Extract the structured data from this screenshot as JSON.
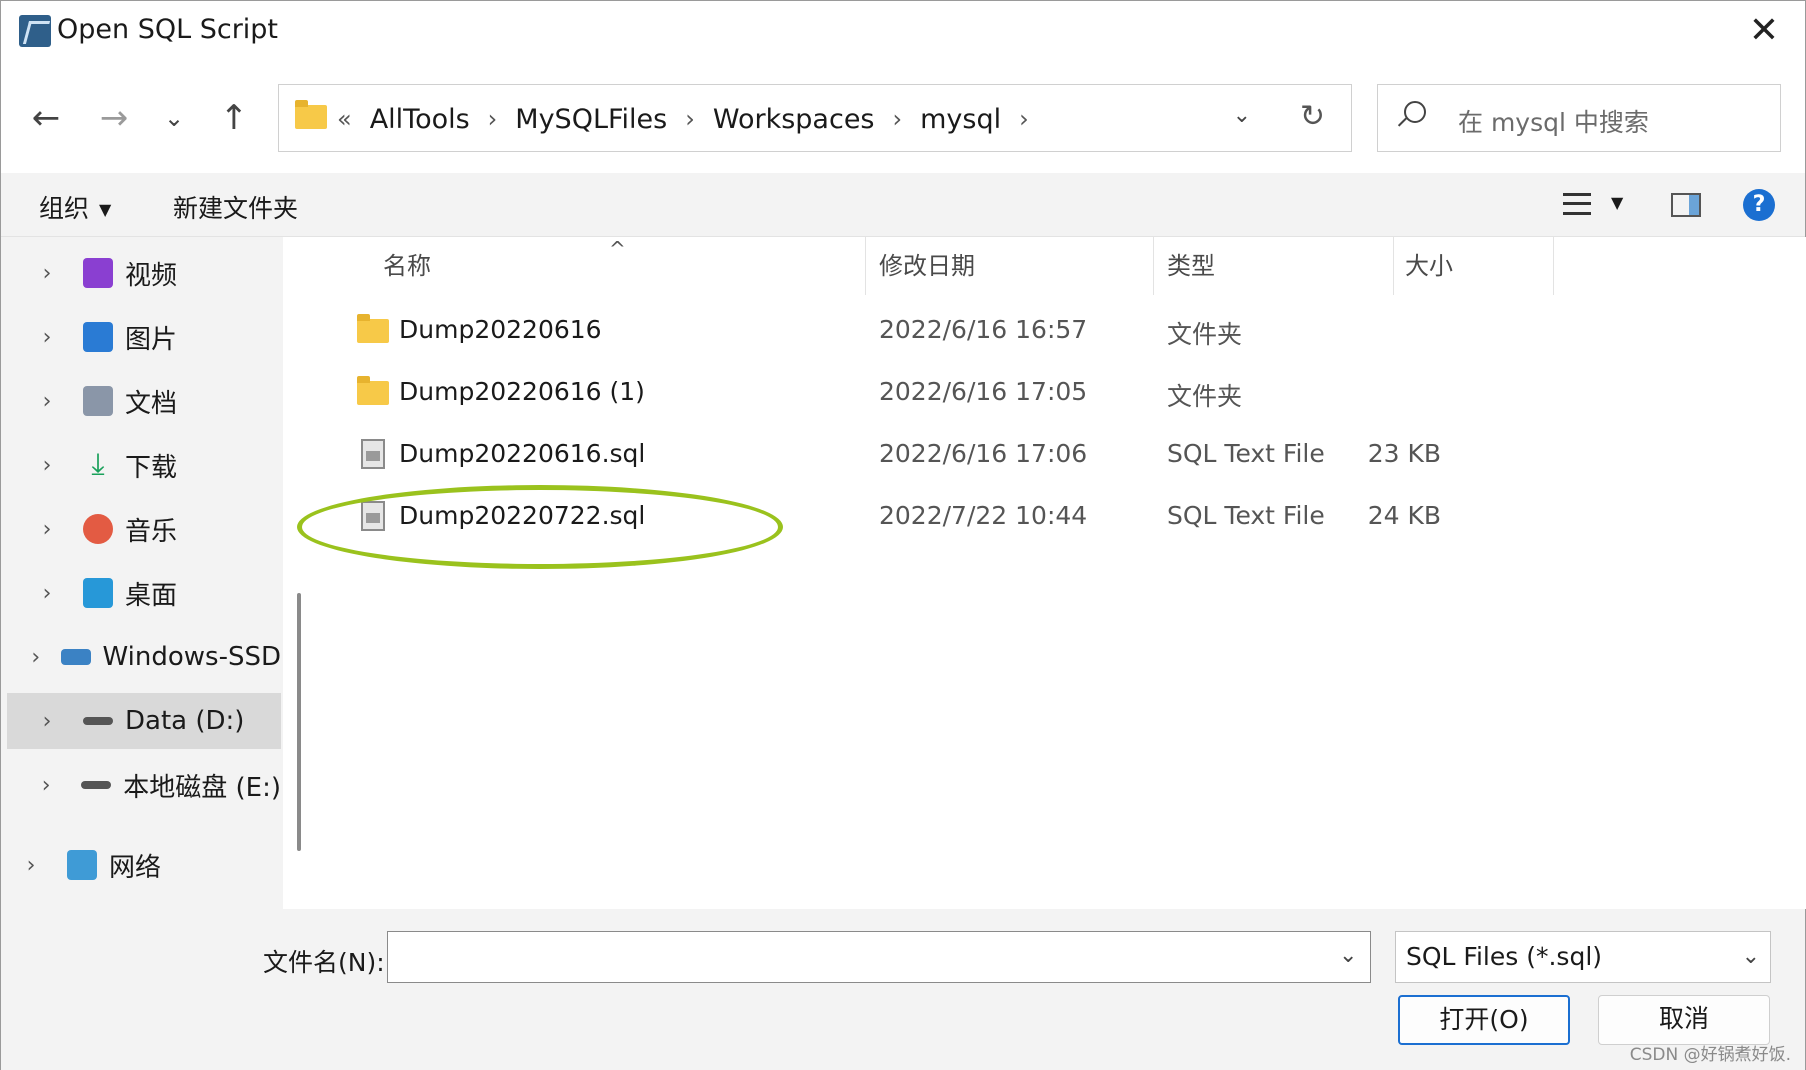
{
  "window": {
    "title": "Open SQL Script",
    "close_glyph": "✕"
  },
  "nav": {
    "back_glyph": "←",
    "forward_glyph": "→",
    "recent_glyph": "⌄",
    "up_glyph": "↑"
  },
  "address": {
    "lead": "«",
    "crumbs": [
      "AllTools",
      "MySQLFiles",
      "Workspaces",
      "mysql"
    ],
    "sep": "›",
    "dropdown_glyph": "⌄",
    "refresh_glyph": "↻"
  },
  "search": {
    "placeholder": "在 mysql 中搜索"
  },
  "toolbar": {
    "organize": "组织",
    "organize_caret": "▼",
    "new_folder": "新建文件夹",
    "view_caret": "▼",
    "help": "?"
  },
  "sidebar": {
    "items": [
      {
        "label": "视频",
        "icon": "video-icon"
      },
      {
        "label": "图片",
        "icon": "pictures-icon"
      },
      {
        "label": "文档",
        "icon": "documents-icon"
      },
      {
        "label": "下载",
        "icon": "download-icon"
      },
      {
        "label": "音乐",
        "icon": "music-icon"
      },
      {
        "label": "桌面",
        "icon": "desktop-icon"
      },
      {
        "label": "Windows-SSD",
        "icon": "windows-drive-icon"
      },
      {
        "label": "Data (D:)",
        "icon": "drive-icon",
        "selected": true
      },
      {
        "label": "本地磁盘 (E:)",
        "icon": "drive-icon"
      },
      {
        "label": "网络",
        "icon": "network-icon"
      }
    ],
    "chevron": "›",
    "download_glyph": "⤓"
  },
  "columns": {
    "name": "名称",
    "date": "修改日期",
    "type": "类型",
    "size": "大小",
    "sort_glyph": "^"
  },
  "files": [
    {
      "name": "Dump20220616",
      "date": "2022/6/16 16:57",
      "type": "文件夹",
      "size": "",
      "kind": "folder"
    },
    {
      "name": "Dump20220616 (1)",
      "date": "2022/6/16 17:05",
      "type": "文件夹",
      "size": "",
      "kind": "folder"
    },
    {
      "name": "Dump20220616.sql",
      "date": "2022/6/16 17:06",
      "type": "SQL Text File",
      "size": "23 KB",
      "kind": "file"
    },
    {
      "name": "Dump20220722.sql",
      "date": "2022/7/22 10:44",
      "type": "SQL Text File",
      "size": "24 KB",
      "kind": "file"
    }
  ],
  "bottom": {
    "filename_label": "文件名(N):",
    "filename_value": "",
    "filetype": "SQL Files (*.sql)",
    "dropdown_glyph": "⌄",
    "open_button": "打开(O)",
    "cancel_button": "取消",
    "watermark": "CSDN @好锅煮好饭."
  },
  "colors": {
    "accent": "#1b6fd1",
    "highlight": "#9ac21d",
    "folder": "#f7c948"
  }
}
